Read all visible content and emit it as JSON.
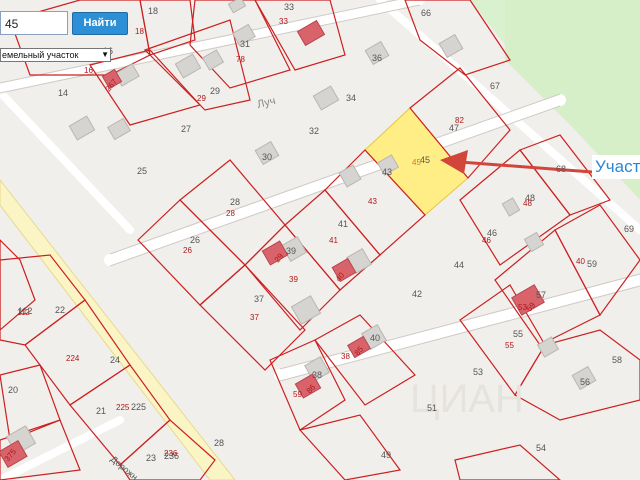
{
  "search": {
    "value": "45",
    "button_label": "Найти"
  },
  "object_type": {
    "selected": "емельный участок"
  },
  "callout": {
    "label": "Участ"
  },
  "colors": {
    "parcel_border": "#cc2020",
    "parcel_label": "#b01818",
    "building_label": "#555555",
    "highlight_fill": "#ffeb7a",
    "forest": "#d7f0cd",
    "road": "#fbf6c8"
  },
  "street_labels": {
    "street": "Луч",
    "road": "Дорожн"
  },
  "watermark": "ЦИАН",
  "gray_labels": [
    "18",
    "16",
    "14",
    "33",
    "31",
    "29",
    "27",
    "25",
    "36",
    "34",
    "32",
    "30",
    "28",
    "26",
    "37",
    "39",
    "41",
    "43",
    "45",
    "47",
    "66",
    "67",
    "68",
    "69",
    "48",
    "46",
    "44",
    "42",
    "40",
    "38",
    "59",
    "55",
    "53",
    "51",
    "49",
    "112",
    "22",
    "24",
    "20",
    "21",
    "23",
    "28",
    "225",
    "236",
    "56",
    "58",
    "54",
    "57"
  ],
  "red_labels": [
    "18",
    "16",
    "267",
    "33",
    "78",
    "29",
    "82",
    "45",
    "43",
    "48",
    "28",
    "26",
    "41",
    "29",
    "39",
    "37",
    "38",
    "85",
    "59",
    "86",
    "40",
    "55",
    "53",
    "46",
    "40",
    "59",
    "112",
    "224",
    "225",
    "236",
    "375"
  ]
}
